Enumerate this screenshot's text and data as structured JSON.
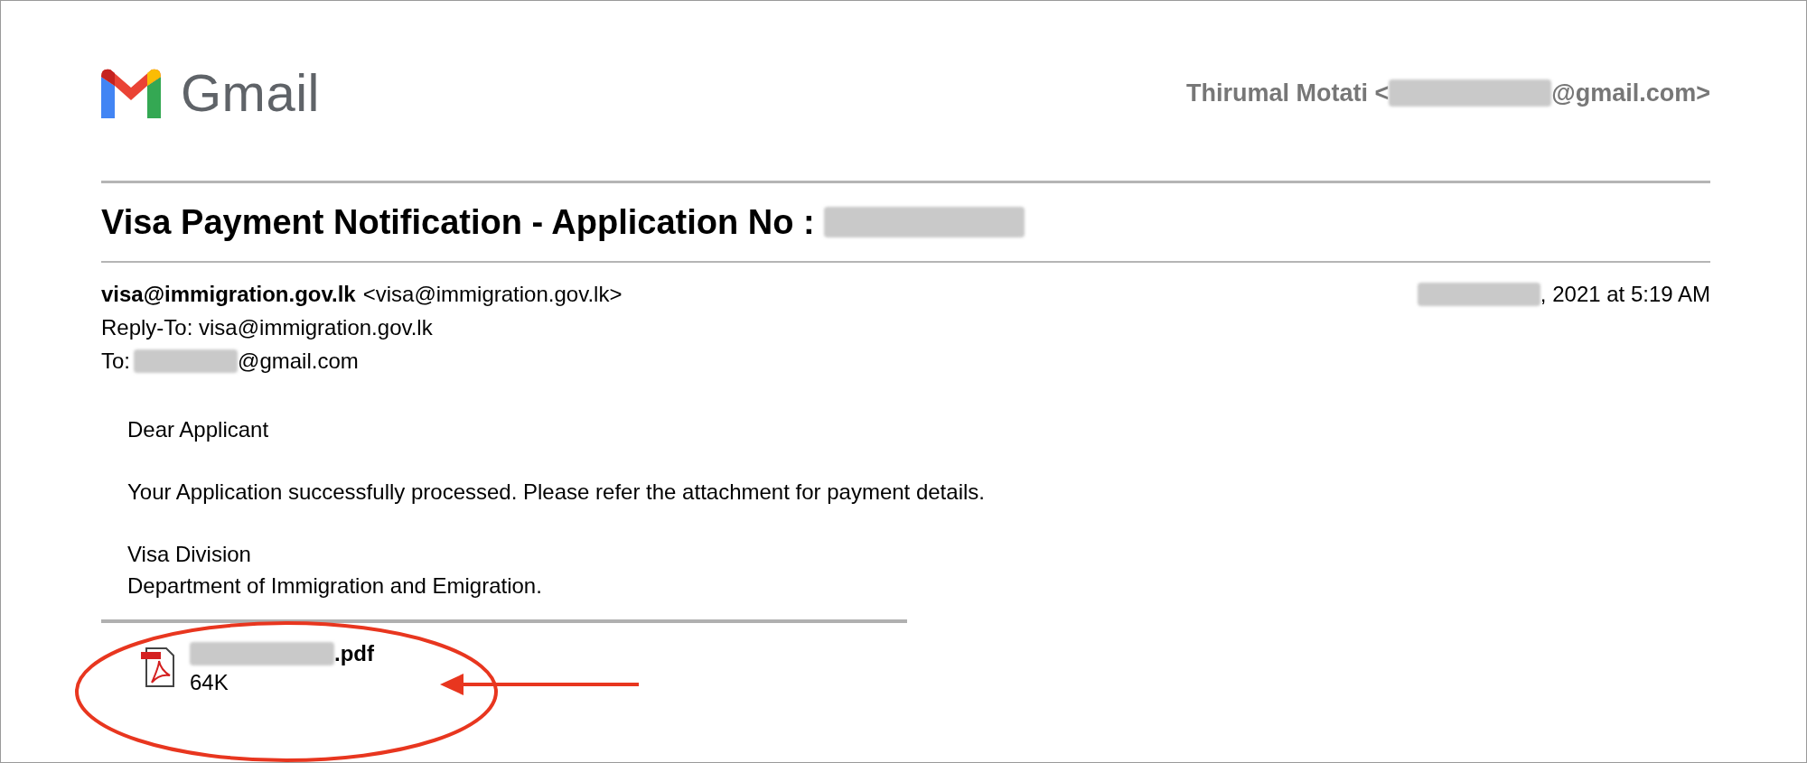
{
  "header": {
    "logo_text": "Gmail",
    "account": {
      "text_before": "Thirumal Motati <",
      "text_after": "@gmail.com>"
    }
  },
  "subject": {
    "text": "Visa Payment Notification - Application No :"
  },
  "message": {
    "from_address": "visa@immigration.gov.lk",
    "from_display": "<visa@immigration.gov.lk>",
    "date_after": ", 2021 at 5:19 AM",
    "reply_to": "Reply-To: visa@immigration.gov.lk",
    "to_label": "To:",
    "to_after": "@gmail.com"
  },
  "body": [
    {
      "lines": [
        "Dear Applicant"
      ]
    },
    {
      "lines": [
        "Your Application successfully processed. Please refer the attachment for payment details."
      ]
    },
    {
      "lines": [
        "Visa Division",
        "Department of Immigration and Emigration."
      ]
    }
  ],
  "attachment": {
    "name_after": ".pdf",
    "size": "64K"
  }
}
